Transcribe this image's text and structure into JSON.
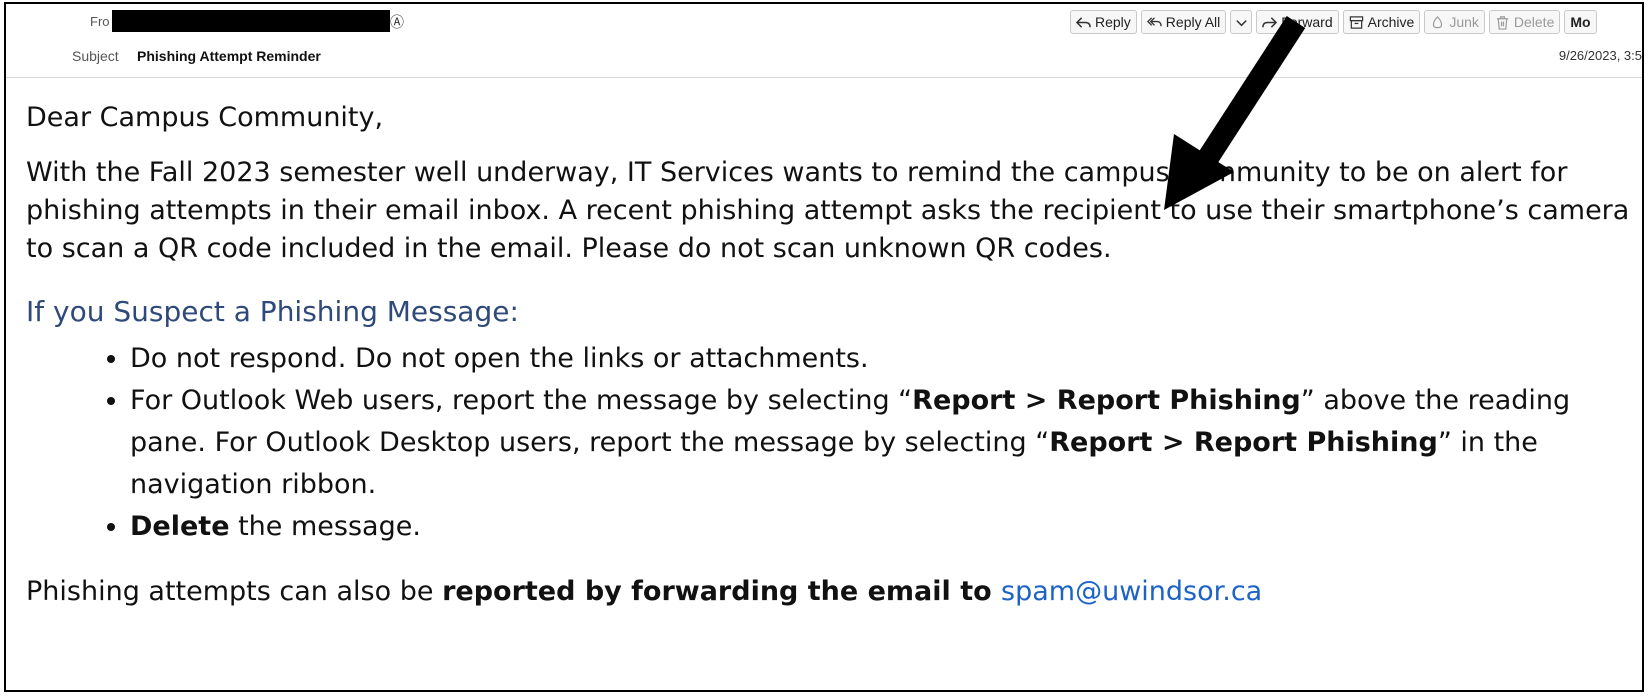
{
  "header": {
    "from_label": "Fro",
    "subject_label": "Subject",
    "subject_value": "Phishing Attempt Reminder",
    "date": "9/26/2023, 3:5"
  },
  "toolbar": {
    "reply": "Reply",
    "reply_all": "Reply All",
    "forward": "Forward",
    "archive": "Archive",
    "junk": "Junk",
    "delete": "Delete",
    "more": "Mo"
  },
  "email": {
    "greeting": "Dear Campus Community,",
    "paragraph": "With the Fall 2023 semester well underway, IT Services wants to remind the campus community to be on alert for phishing attempts in their email inbox. A recent phishing attempt asks the recipient to use their smartphone’s camera to scan a QR code included in the email. Please do not scan unknown QR codes.",
    "heading": "If you Suspect a Phishing Message:",
    "bullet1": "Do not respond. Do not open the links or attachments.",
    "bullet2_a": "For Outlook Web users, report the message by selecting “",
    "bullet2_b": "Report > Report Phishing",
    "bullet2_c": "” above the reading pane. For Outlook Desktop users, report the message by selecting “",
    "bullet2_d": "Report > Report Phishing",
    "bullet2_e": "” in the navigation ribbon.",
    "bullet3_bold": "Delete",
    "bullet3_rest": " the message.",
    "trail_a": "Phishing attempts can also be ",
    "trail_bold": "reported by forwarding the email to ",
    "trail_link": "spam@uwindsor.ca"
  },
  "colors": {
    "heading": "#2f4a7a",
    "link": "#1d63c6"
  }
}
